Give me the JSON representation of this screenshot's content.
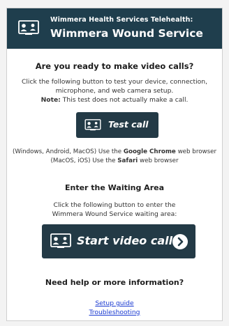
{
  "header": {
    "pretitle": "Wimmera Health Services Telehealth:",
    "title": "Wimmera Wound Service"
  },
  "test": {
    "heading": "Are you ready to make video calls?",
    "line1": "Click the following button to test your device, connection,",
    "line2": "microphone, and web camera setup.",
    "note_label": "Note:",
    "note_text": " This test does not actually make a call.",
    "button_label": "Test call"
  },
  "browsers": {
    "line1_pre": "(Windows, Android, MacOS) Use the ",
    "line1_bold": "Google Chrome",
    "line1_post": " web browser",
    "line2_pre": "(MacOS, iOS) Use the ",
    "line2_bold": "Safari",
    "line2_post": " web browser"
  },
  "waiting": {
    "heading": "Enter the Waiting Area",
    "line1": "Click the following button to enter the",
    "line2": "Wimmera Wound Service waiting area:",
    "button_label": "Start video call"
  },
  "help": {
    "heading": "Need help or more information?",
    "links": [
      "Setup guide",
      "Troubleshooting"
    ]
  },
  "colors": {
    "header_bg": "#1f3e4d",
    "button_bg": "#233a46",
    "link": "#1a3ad1"
  },
  "icons": [
    "video-call-icon",
    "chevron-right-icon"
  ]
}
